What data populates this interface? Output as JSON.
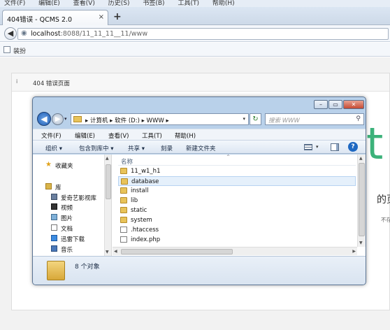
{
  "browser": {
    "menu": [
      "文件(F)",
      "编辑(E)",
      "查看(V)",
      "历史(S)",
      "书签(B)",
      "工具(T)",
      "帮助(H)"
    ],
    "tab": {
      "title": "404错误 - QCMS 2.0",
      "close": "×"
    },
    "new_tab": "+",
    "back": "◀",
    "url": {
      "host": "localhost",
      "rest": ":8088/11_11_11__11/www"
    },
    "bookmark": "装扮"
  },
  "page": {
    "info_icon": "i",
    "panel_title": "404 错误页面",
    "bg_digit": "t",
    "bg_heading": "的页",
    "bg_sub": "不存在本"
  },
  "explorer": {
    "window_controls": {
      "min": "–",
      "max": "▭",
      "close": "✕"
    },
    "back": "◀",
    "forward": "▶",
    "history": "▾",
    "path": "▸ 计算机 ▸ 软件 (D:) ▸ WWW ▸",
    "path_drop": "▾",
    "refresh": "↻",
    "search_placeholder": "搜索 WWW",
    "search_icon": "⚲",
    "menu": [
      "文件(F)",
      "编辑(E)",
      "查看(V)",
      "工具(T)",
      "帮助(H)"
    ],
    "commands": [
      "组织 ▾",
      "包含到库中 ▾",
      "共享 ▾",
      "刻录",
      "新建文件夹"
    ],
    "view_drop": "▾",
    "help": "?",
    "nav": [
      {
        "label": "收藏夹",
        "icon": "star-icon"
      },
      {
        "label": "库",
        "icon": "library-icon"
      },
      {
        "label": "爱奇艺影视库",
        "icon": "video-library-icon"
      },
      {
        "label": "视频",
        "icon": "video-icon"
      },
      {
        "label": "图片",
        "icon": "picture-icon"
      },
      {
        "label": "文档",
        "icon": "document-icon"
      },
      {
        "label": "迅雷下载",
        "icon": "download-icon"
      },
      {
        "label": "音乐",
        "icon": "music-icon"
      }
    ],
    "column_header": "名称",
    "column_caret": "^",
    "files": [
      {
        "name": "11_w1_h1",
        "type": "folder"
      },
      {
        "name": "database",
        "type": "folder",
        "selected": true
      },
      {
        "name": "install",
        "type": "folder"
      },
      {
        "name": "lib",
        "type": "folder"
      },
      {
        "name": "static",
        "type": "folder"
      },
      {
        "name": "system",
        "type": "folder"
      },
      {
        "name": ".htaccess",
        "type": "file"
      },
      {
        "name": "index.php",
        "type": "file"
      }
    ],
    "status": "8 个对象"
  },
  "colors": {
    "accent_green": "#3cb27a",
    "explorer_frame": "#b9d1ea",
    "folder": "#e8c35a",
    "selection": "#e5f0fb"
  }
}
